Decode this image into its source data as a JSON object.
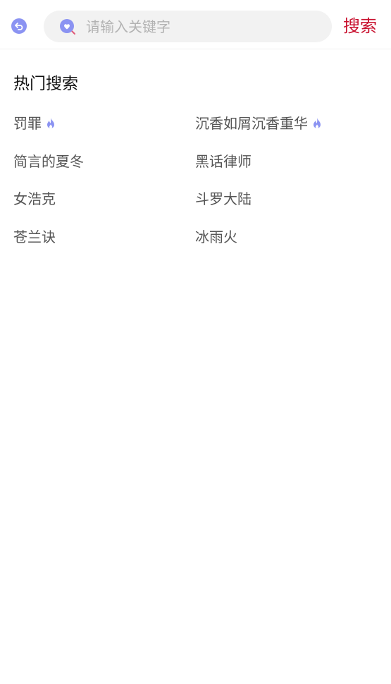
{
  "header": {
    "search_placeholder": "请输入关键字",
    "search_button": "搜索"
  },
  "hot": {
    "title": "热门搜索",
    "items": [
      {
        "label": "罚罪",
        "hot": true
      },
      {
        "label": "沉香如屑沉香重华",
        "hot": true
      },
      {
        "label": "简言的夏冬",
        "hot": false
      },
      {
        "label": "黑话律师",
        "hot": false
      },
      {
        "label": "女浩克",
        "hot": false
      },
      {
        "label": "斗罗大陆",
        "hot": false
      },
      {
        "label": "苍兰诀",
        "hot": false
      },
      {
        "label": "冰雨火",
        "hot": false
      }
    ]
  },
  "colors": {
    "accent": "#c8102e",
    "icon": "#8b93f2",
    "search_bg": "#f2f2f2"
  },
  "icons": [
    "back-arrow-icon",
    "search-heart-icon",
    "flame-icon"
  ]
}
